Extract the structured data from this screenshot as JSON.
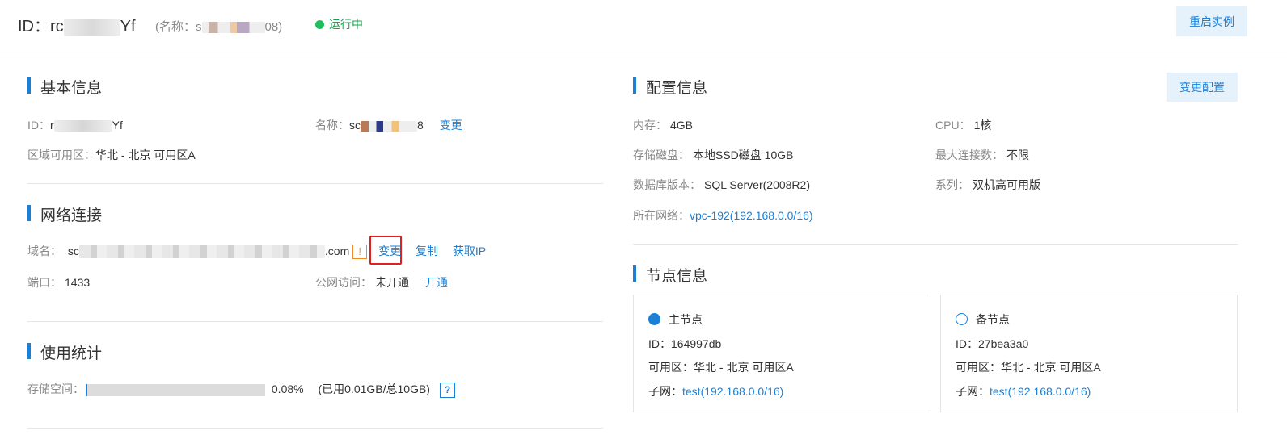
{
  "header": {
    "id_prefix": "ID：",
    "id_value_start": "rc",
    "id_value_end": "Yf",
    "name_prefix": "(名称：",
    "name_value_start": "s",
    "name_value_end": "08)",
    "status": "运行中",
    "status_color": "#1fbf5f",
    "restart_label": "重启实例"
  },
  "basic": {
    "title": "基本信息",
    "id_label": "ID：",
    "id_value_start": "r",
    "id_value_end": "Yf",
    "name_label": "名称：",
    "name_value_start": "sc",
    "name_value_end": "8",
    "name_change": "变更",
    "zone_label": "区域可用区：",
    "zone_value": "华北 - 北京 可用区A"
  },
  "network": {
    "title": "网络连接",
    "domain_label": "域名：",
    "domain_start": "sc",
    "domain_end": ".com",
    "warn_glyph": "!",
    "change": "变更",
    "copy": "复制",
    "get_ip": "获取IP",
    "port_label": "端口：",
    "port_value": "1433",
    "public_label": "公网访问：",
    "public_value": "未开通",
    "public_action": "开通"
  },
  "usage": {
    "title": "使用统计",
    "storage_label": "存储空间：",
    "storage_percent": "0.08%",
    "storage_fraction": 0.0008,
    "storage_detail": "(已用0.01GB/总10GB)",
    "help_glyph": "?"
  },
  "config": {
    "title": "配置信息",
    "change_label": "变更配置",
    "memory_label": "内存：",
    "memory_value": "4GB",
    "cpu_label": "CPU：",
    "cpu_value": "1核",
    "disk_label": "存储磁盘：",
    "disk_value": "本地SSD磁盘 10GB",
    "maxconn_label": "最大连接数：",
    "maxconn_value": "不限",
    "dbver_label": "数据库版本：",
    "dbver_value": "SQL Server(2008R2)",
    "series_label": "系列：",
    "series_value": "双机高可用版",
    "net_label": "所在网络：",
    "net_value": "vpc-192(192.168.0.0/16)"
  },
  "nodes": {
    "title": "节点信息",
    "primary": {
      "label": "主节点",
      "id_label": "ID：",
      "id_value": "164997db",
      "zone_label": "可用区：",
      "zone_value": "华北 - 北京 可用区A",
      "subnet_label": "子网：",
      "subnet_value": "test(192.168.0.0/16)"
    },
    "backup": {
      "label": "备节点",
      "id_label": "ID：",
      "id_value": "27bea3a0",
      "zone_label": "可用区：",
      "zone_value": "华北 - 北京 可用区A",
      "subnet_label": "子网：",
      "subnet_value": "test(192.168.0.0/16)"
    }
  }
}
